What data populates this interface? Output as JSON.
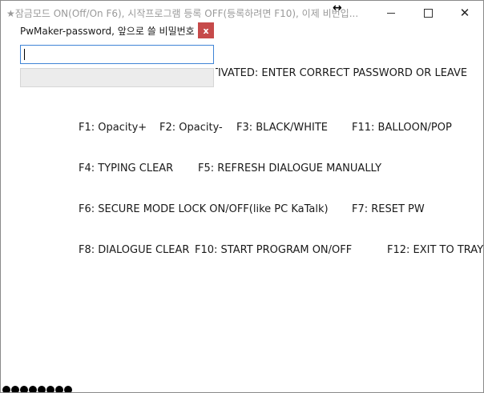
{
  "window": {
    "title": "★잠금모드 ON(Off/On F6), 시작프로그램 등록 OFF(등록하려면 F10), 이제 비번입...",
    "resize_icon": "↔",
    "minimize_icon": "minimize-icon",
    "maximize_icon": "maximize-icon",
    "close_label": "✕"
  },
  "pw_dialog": {
    "title": "PwMaker-password, 앞으로 쓸 비밀번호",
    "close_label": "x",
    "input_value": "",
    "button_label": ""
  },
  "status_line": "TIVATED: ENTER CORRECT PASSWORD OR LEAVE",
  "shortcuts": {
    "row1": [
      "F1: Opacity+",
      "F2: Opacity-",
      "F3: BLACK/WHITE",
      "F11: BALLOON/POP"
    ],
    "row2": [
      "F4: TYPING CLEAR",
      "F5: REFRESH DIALOGUE MANUALLY"
    ],
    "row3": [
      "F6: SECURE MODE LOCK ON/OFF(like PC KaTalk)",
      "F7: RESET PW"
    ],
    "row4": [
      "F8: DIALOGUE CLEAR",
      "F10: START PROGRAM ON/OFF",
      "F12: EXIT TO TRAY"
    ]
  },
  "password_mask_count": 8
}
